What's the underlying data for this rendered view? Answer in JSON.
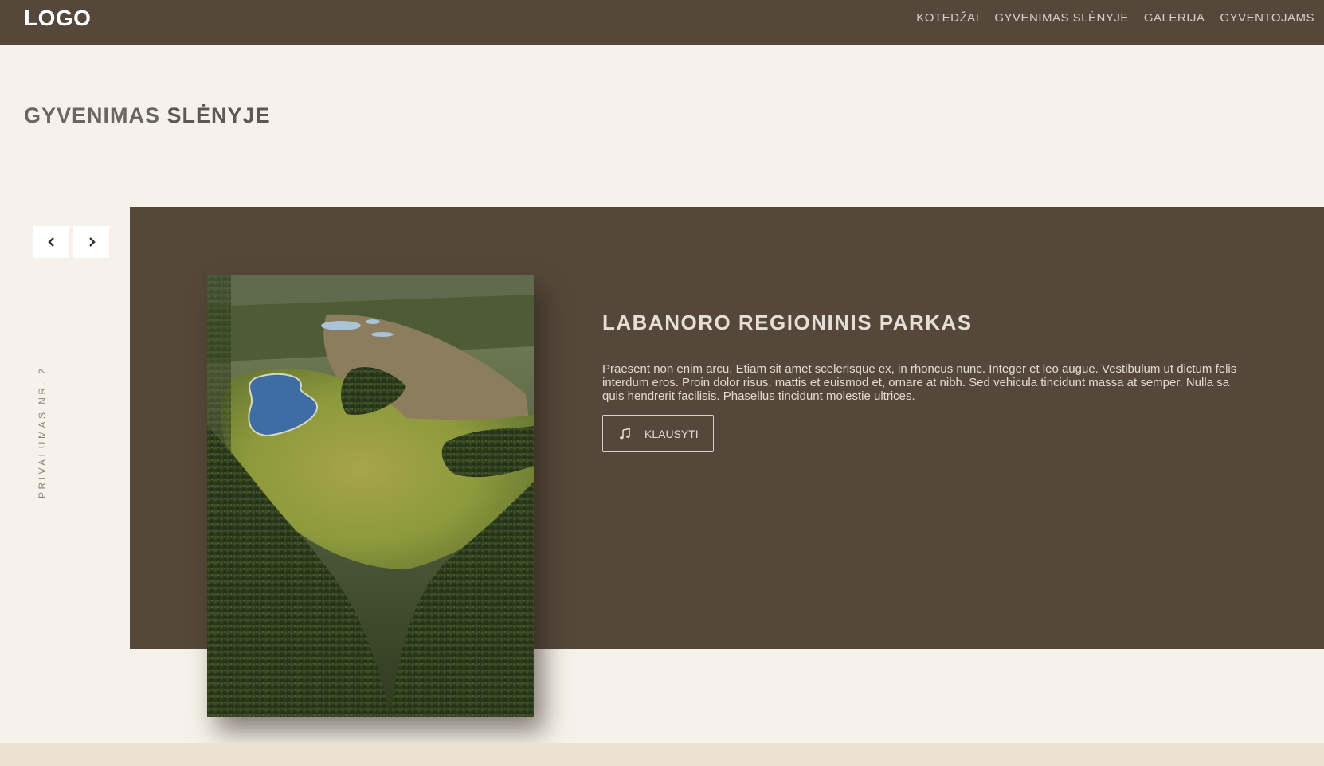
{
  "header": {
    "logo": "LOGO",
    "nav": [
      {
        "label": "KOTEDŽAI"
      },
      {
        "label": "GYVENIMAS SLĖNYJE"
      },
      {
        "label": "GALERIJA"
      },
      {
        "label": "GYVENTOJAMS"
      }
    ]
  },
  "section": {
    "title_light": "GYVENIMAS ",
    "title_bold": "SLĖNYJE"
  },
  "slider": {
    "prev_icon": "chevron-left-icon",
    "next_icon": "chevron-right-icon",
    "vertical_label": "PRIVALUMAS NR. 2"
  },
  "slide": {
    "title": "LABANORO REGIONINIS PARKAS",
    "description_lines": [
      "Praesent non enim arcu. Etiam sit amet scelerisque ex, in rhoncus nunc. Integer et leo augue. Vestibulum ut dictum felis",
      "interdum eros. Proin dolor risus, mattis et euismod et, ornare at nibh. Sed vehicula tincidunt massa at semper. Nulla sa",
      "quis hendrerit facilisis. Phasellus tincidunt molestie ultrices."
    ],
    "listen_button": "KLAUSYTI",
    "listen_icon": "music-note-icon"
  },
  "colors": {
    "header_bg": "#55483a",
    "page_bg": "#f6f1ea",
    "panel_bg": "#55483a",
    "footer_bg": "#ebe2d3"
  }
}
